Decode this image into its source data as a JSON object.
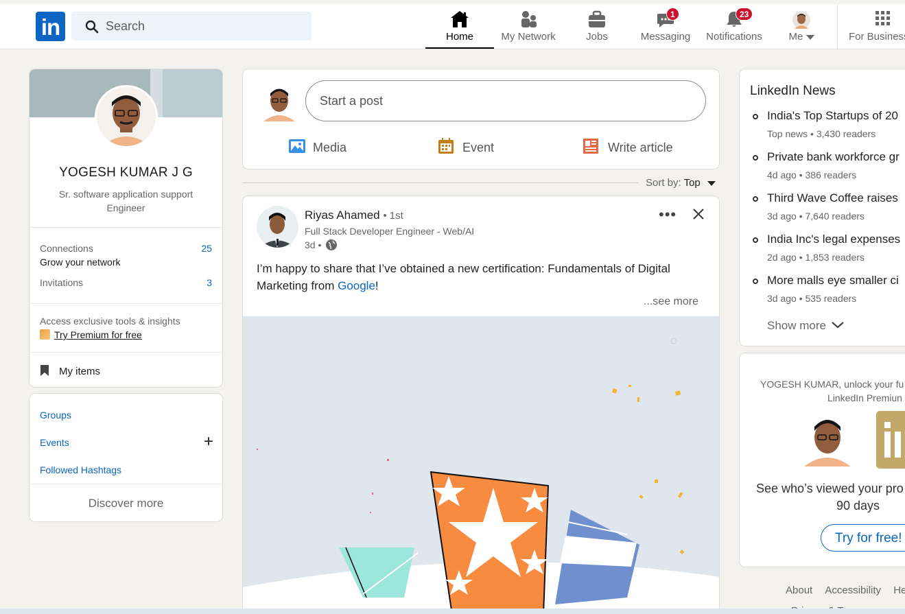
{
  "nav": {
    "search_placeholder": "Search",
    "items": [
      {
        "label": "Home",
        "icon": "home-icon",
        "active": true
      },
      {
        "label": "My Network",
        "icon": "people-icon"
      },
      {
        "label": "Jobs",
        "icon": "briefcase-icon"
      },
      {
        "label": "Messaging",
        "icon": "chat-icon",
        "badge": "1"
      },
      {
        "label": "Notifications",
        "icon": "bell-icon",
        "badge": "23"
      },
      {
        "label": "Me",
        "icon": "avatar"
      },
      {
        "label": "For Business",
        "icon": "grid-icon"
      }
    ]
  },
  "profile": {
    "name": "YOGESH KUMAR J G",
    "headline": "Sr. software application support Engineer",
    "connections_label": "Connections",
    "connections_sub": "Grow your network",
    "connections_count": "25",
    "invitations_label": "Invitations",
    "invitations_count": "3",
    "premium_text": "Access exclusive tools & insights",
    "premium_link": "Try Premium for free",
    "my_items": "My items"
  },
  "communities": {
    "groups": "Groups",
    "events": "Events",
    "hashtags": "Followed Hashtags",
    "discover": "Discover more"
  },
  "composer": {
    "placeholder": "Start a post",
    "media": "Media",
    "event": "Event",
    "article": "Write article"
  },
  "sort": {
    "label": "Sort by:",
    "value": "Top"
  },
  "post": {
    "author": "Riyas Ahamed",
    "degree": "• 1st",
    "headline": "Full Stack Developer Engineer - Web/AI",
    "time": "3d •",
    "text_before": "I’m happy to share that I’ve obtained a new certification: Fundamentals of Digital Marketing from ",
    "text_link": "Google",
    "text_after": "!",
    "see_more": "...see more"
  },
  "news": {
    "title": "LinkedIn News",
    "items": [
      {
        "headline": "India's Top Startups of 20",
        "meta": "Top news • 3,430 readers"
      },
      {
        "headline": "Private bank workforce gr",
        "meta": "4d ago • 386 readers"
      },
      {
        "headline": "Third Wave Coffee raises",
        "meta": "3d ago • 7,640 readers"
      },
      {
        "headline": "India Inc's legal expenses",
        "meta": "2d ago • 1,853 readers"
      },
      {
        "headline": "More malls eye smaller ci",
        "meta": "3d ago • 535 readers"
      }
    ],
    "show_more": "Show more"
  },
  "premium_ad": {
    "line1": "YOGESH KUMAR, unlock your fu",
    "line2": "LinkedIn Premiun",
    "body1": "See who’s viewed your pro",
    "body2": "90 days",
    "cta": "Try for free!"
  },
  "footer": {
    "about": "About",
    "accessibility": "Accessibility",
    "help": "He",
    "privacy": "Privacy & Terms"
  }
}
